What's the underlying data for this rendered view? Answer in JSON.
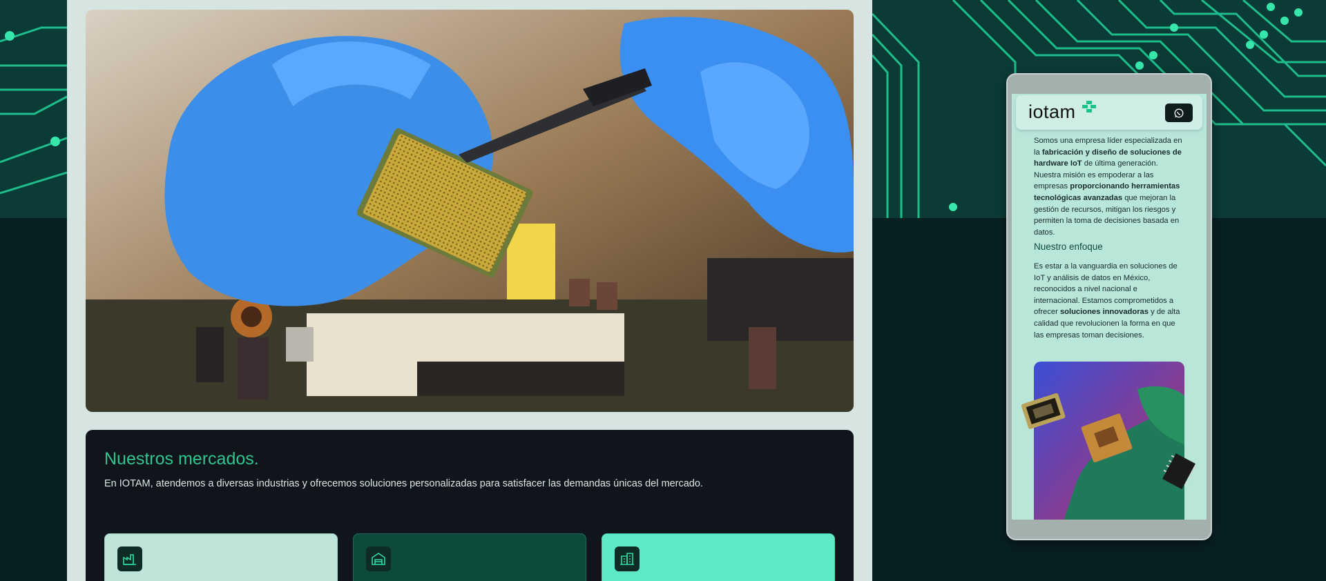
{
  "markets": {
    "title": "Nuestros mercados.",
    "subtitle": "En IOTAM, atendemos a diversas industrias y ofrecemos soluciones personalizadas para satisfacer las demandas únicas del mercado."
  },
  "cards": [
    {
      "icon": "factory-icon"
    },
    {
      "icon": "warehouse-icon"
    },
    {
      "icon": "building-icon"
    }
  ],
  "phone": {
    "logo": "iotam",
    "whatsapp_icon": "whatsapp-icon",
    "p1_a": "Somos una empresa líder especializada en la ",
    "p1_b": "fabricación y diseño de soluciones de hardware IoT",
    "p1_c": " de última generación. Nuestra misión es empoderar a las empresas ",
    "p1_d": "proporcionando herramientas tecnológicas avanzadas",
    "p1_e": " que mejoran la gestión de recursos, mitigan los riesgos y permiten la toma de decisiones basada en datos.",
    "heading": "Nuestro enfoque",
    "p2_a": "Es estar a la vanguardia en soluciones de IoT y análisis de datos en México, reconocidos a nivel nacional e internacional. Estamos comprometidos a ofrecer ",
    "p2_b": "soluciones innovadoras",
    "p2_c": " y de alta calidad que revolucionen la forma en que las empresas toman decisiones."
  },
  "colors": {
    "accent": "#30c58e",
    "dark": "#0f151a",
    "mint": "#b8e7da",
    "page_bg": "#082022"
  }
}
